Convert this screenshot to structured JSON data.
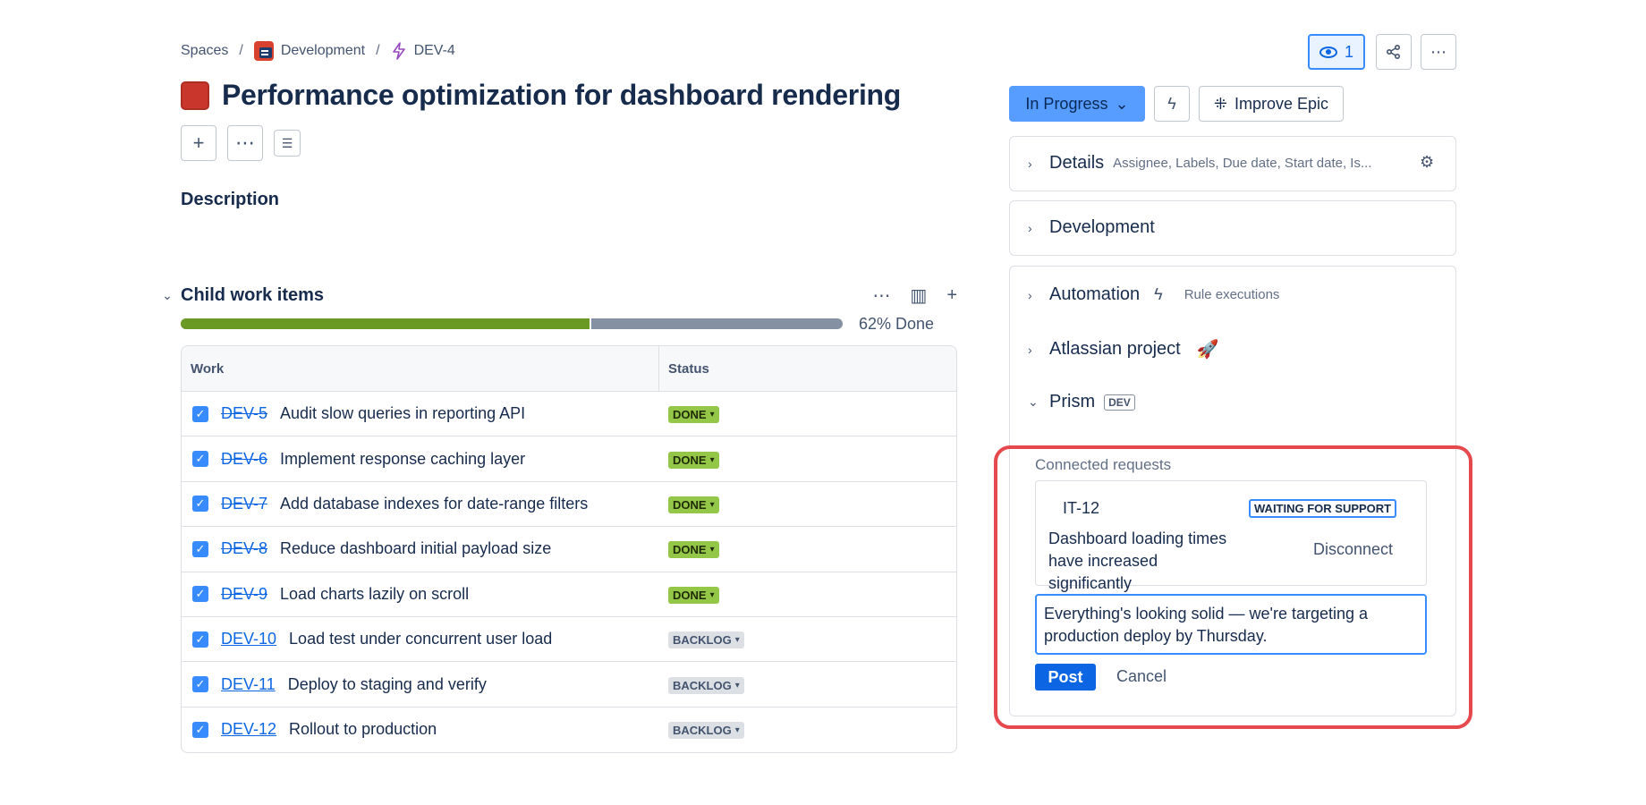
{
  "breadcrumb": {
    "spaces": "Spaces",
    "space": "Development",
    "issue": "DEV-4",
    "sep": "/"
  },
  "title": "Performance optimization for dashboard rendering",
  "description_label": "Description",
  "child": {
    "label": "Child work items",
    "progress_percent": 62,
    "progress_label": "62% Done",
    "columns": [
      "Work",
      "Status"
    ],
    "rows": [
      {
        "key": "DEV-5",
        "summary": "Audit slow queries in reporting API",
        "status": "DONE",
        "done": true
      },
      {
        "key": "DEV-6",
        "summary": "Implement response caching layer",
        "status": "DONE",
        "done": true
      },
      {
        "key": "DEV-7",
        "summary": "Add database indexes for date-range filters",
        "status": "DONE",
        "done": true
      },
      {
        "key": "DEV-8",
        "summary": "Reduce dashboard initial payload size",
        "status": "DONE",
        "done": true
      },
      {
        "key": "DEV-9",
        "summary": "Load charts lazily on scroll",
        "status": "DONE",
        "done": true
      },
      {
        "key": "DEV-10",
        "summary": "Load test under concurrent user load",
        "status": "BACKLOG",
        "done": false
      },
      {
        "key": "DEV-11",
        "summary": "Deploy to staging and verify",
        "status": "BACKLOG",
        "done": false
      },
      {
        "key": "DEV-12",
        "summary": "Rollout to production",
        "status": "BACKLOG",
        "done": false
      }
    ]
  },
  "header": {
    "watch_count": "1"
  },
  "status": {
    "label": "In Progress",
    "improve_label": "Improve Epic"
  },
  "panels": {
    "details_title": "Details",
    "details_sub": "Assignee, Labels, Due date, Start date, Is...",
    "development_title": "Development",
    "automation_title": "Automation",
    "automation_sub": "Rule executions",
    "atlassian_title": "Atlassian project",
    "prism_title": "Prism",
    "prism_badge": "DEV"
  },
  "connected": {
    "label": "Connected requests",
    "key": "IT-12",
    "status": "WAITING FOR SUPPORT",
    "summary": "Dashboard loading times have increased significantly",
    "disconnect": "Disconnect",
    "comment": "Everything's looking solid — we're targeting a production deploy by Thursday.",
    "post": "Post",
    "cancel": "Cancel"
  },
  "colors": {
    "accent": "#0c66e4",
    "status_bg": "#579dff",
    "done_lozenge": "#94c748",
    "progress_done": "#6a9a23",
    "highlight": "#e5484d"
  }
}
